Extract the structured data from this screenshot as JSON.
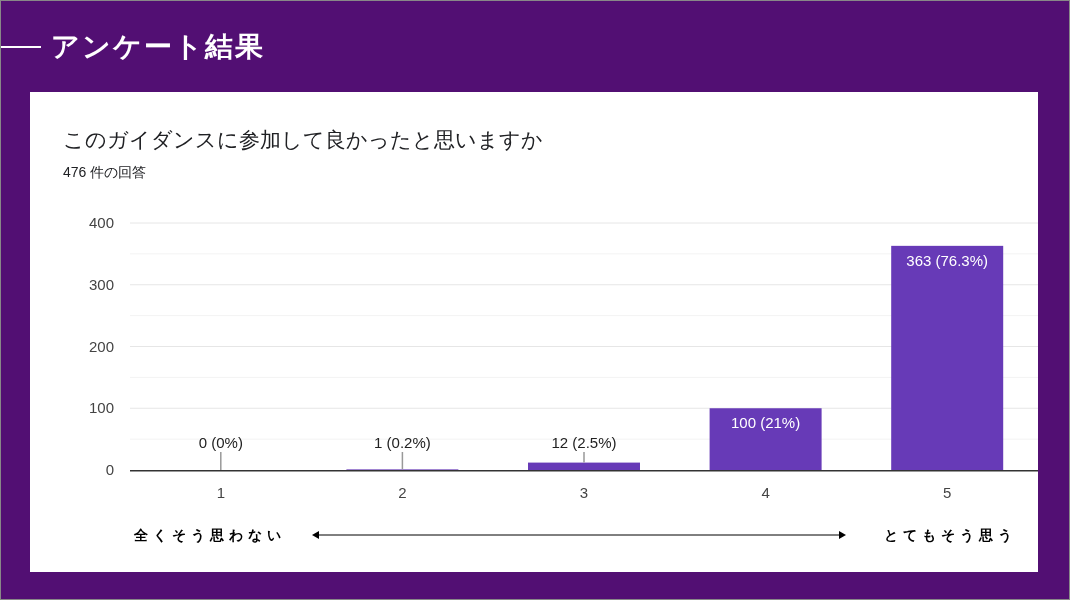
{
  "slide": {
    "title": "アンケート結果"
  },
  "card": {
    "question": "このガイダンスに参加して良かったと思いますか",
    "response_count": "476 件の回答",
    "chart_data": {
      "type": "bar",
      "categories": [
        "1",
        "2",
        "3",
        "4",
        "5"
      ],
      "series": [
        {
          "color": "#673ab7",
          "values": [
            0,
            1,
            12,
            100,
            363
          ]
        }
      ],
      "ylim": [
        0,
        400
      ],
      "grid": true,
      "yticks": [
        0,
        100,
        200,
        300,
        400
      ],
      "value_labels": [
        "0 (0%)",
        "1 (0.2%)",
        "12 (2.5%)",
        "100 (21%)",
        "363 (76.3%)"
      ]
    }
  },
  "scale": {
    "low_label": "全くそう思わない",
    "high_label": "とてもそう思う"
  }
}
